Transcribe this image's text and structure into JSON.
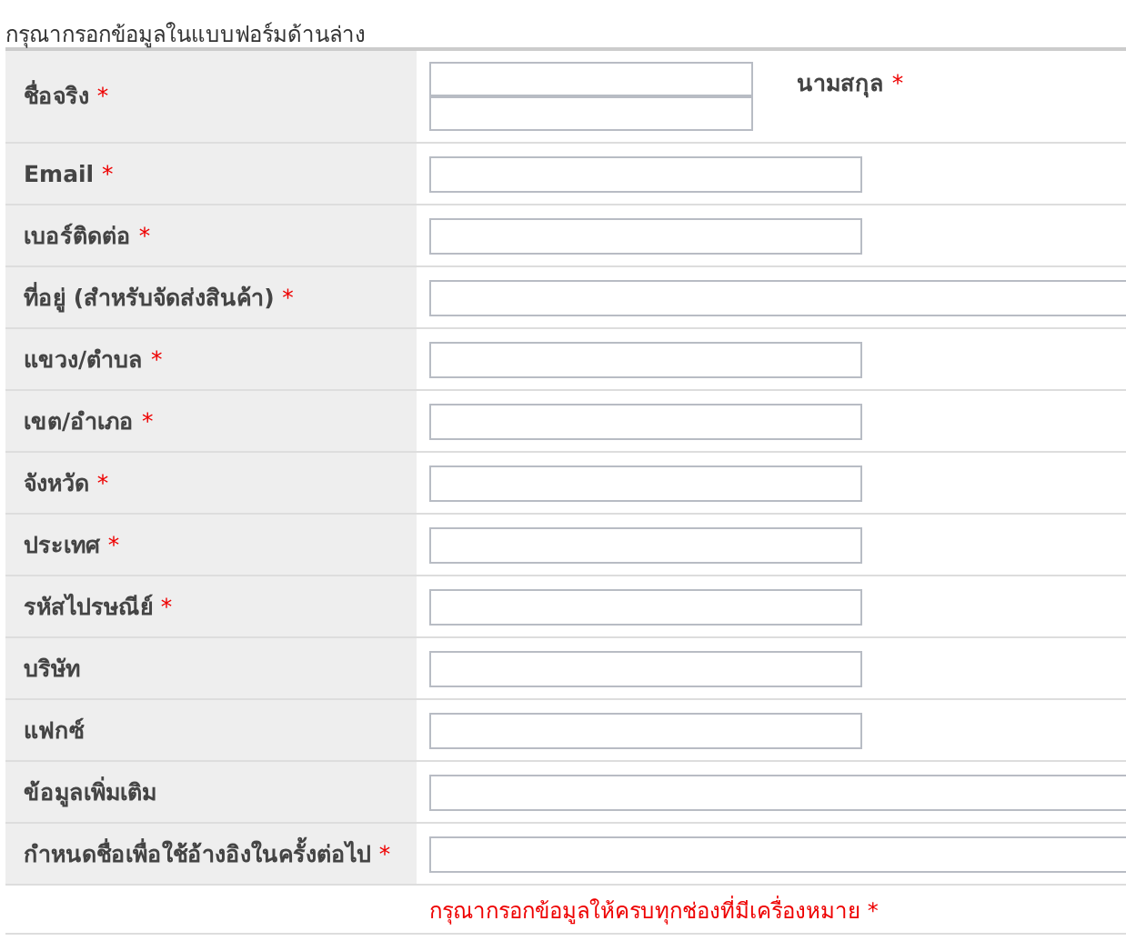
{
  "intro": "กรุณากรอกข้อมูลในแบบฟอร์มด้านล่าง",
  "rows": [
    {
      "label": "ชื่อจริง",
      "required": true,
      "kind": "name",
      "second_label": "นามสกุล",
      "second_required": true
    },
    {
      "label": "Email",
      "required": true,
      "kind": "short"
    },
    {
      "label": "เบอร์ติดต่อ",
      "required": true,
      "kind": "short"
    },
    {
      "label": "ที่อยู่ (สำหรับจัดส่งสินค้า)",
      "required": true,
      "kind": "long"
    },
    {
      "label": "แขวง/ตำบล",
      "required": true,
      "kind": "short"
    },
    {
      "label": "เขต/อำเภอ",
      "required": true,
      "kind": "short"
    },
    {
      "label": "จังหวัด",
      "required": true,
      "kind": "short"
    },
    {
      "label": "ประเทศ",
      "required": true,
      "kind": "short"
    },
    {
      "label": "รหัสไปรษณีย์",
      "required": true,
      "kind": "short"
    },
    {
      "label": "บริษัท",
      "required": false,
      "kind": "short"
    },
    {
      "label": "แฟกซ์",
      "required": false,
      "kind": "short"
    },
    {
      "label": "ข้อมูลเพิ่มเติม",
      "required": false,
      "kind": "long"
    },
    {
      "label": "กำหนดชื่อเพื่อใช้อ้างอิงในครั้งต่อไป",
      "required": true,
      "kind": "long"
    }
  ],
  "footer": {
    "note": "กรุณากรอกข้อมูลให้ครบทุกช่องที่มีเครื่องหมาย",
    "mark": "*"
  }
}
